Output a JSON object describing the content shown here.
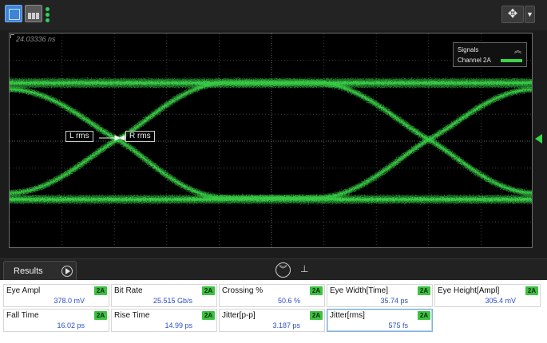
{
  "toolbar": {
    "move_icon": "move-cross-icon",
    "menu_icon": "dropdown-arrow-icon"
  },
  "scope": {
    "timestamp": "24.03336 ns",
    "signal_color": "#3ad64a",
    "legend": {
      "title": "Signals",
      "channel": "Channel 2A",
      "collapse_glyph": "^"
    },
    "markers": {
      "left": "L rms",
      "right": "R rms"
    }
  },
  "results": {
    "tab_label": "Results",
    "collapse_glyph": "⌄",
    "pin_glyph": "🖈"
  },
  "measurements": [
    {
      "name": "Eye Ampl",
      "badge": "2A",
      "value": "378.0 mV"
    },
    {
      "name": "Bit Rate",
      "badge": "2A",
      "value": "25.515 Gb/s"
    },
    {
      "name": "Crossing %",
      "badge": "2A",
      "value": "50.6 %"
    },
    {
      "name": "Eye Width[Time]",
      "badge": "2A",
      "value": "35.74 ps"
    },
    {
      "name": "Eye Height[Ampl]",
      "badge": "2A",
      "value": "305.4 mV"
    },
    {
      "name": "Fall Time",
      "badge": "2A",
      "value": "16.02 ps"
    },
    {
      "name": "Rise Time",
      "badge": "2A",
      "value": "14.99 ps"
    },
    {
      "name": "Jitter[p-p]",
      "badge": "2A",
      "value": "3.187 ps"
    },
    {
      "name": "Jitter[rms]",
      "badge": "2A",
      "value": "575 fs"
    }
  ]
}
